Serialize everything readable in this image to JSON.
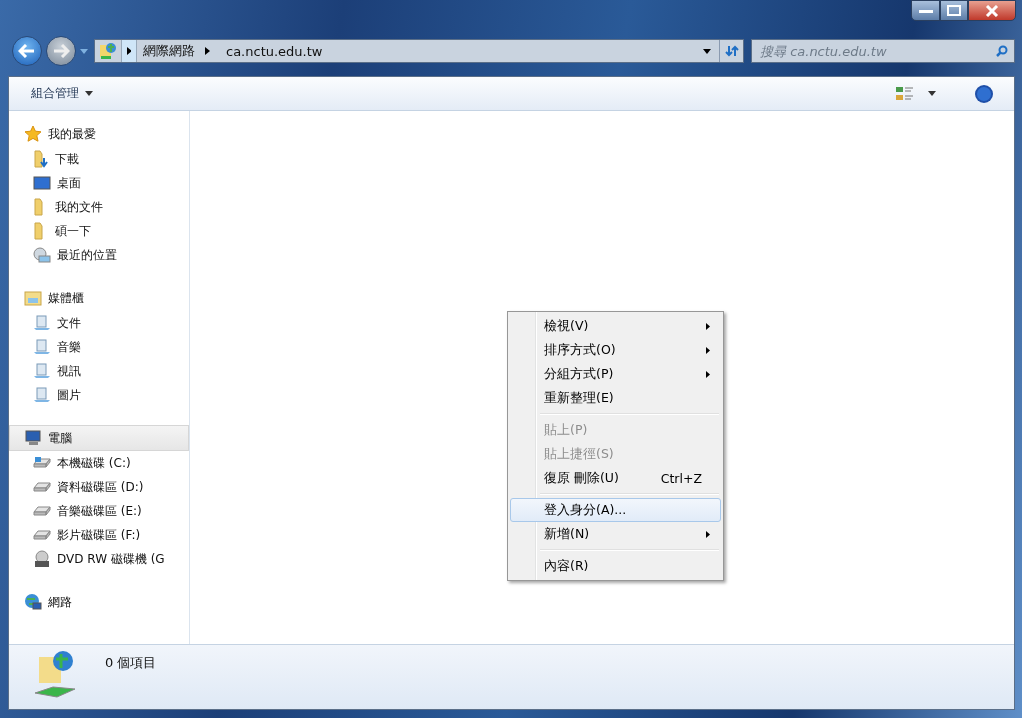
{
  "address_bar": {
    "segments": [
      "網際網路",
      "ca.nctu.edu.tw"
    ]
  },
  "search": {
    "placeholder": "搜尋 ca.nctu.edu.tw"
  },
  "toolbar": {
    "organize": "組合管理"
  },
  "sidebar": {
    "groups": [
      {
        "label": "我的最愛",
        "selected": false,
        "items": [
          {
            "label": "下載"
          },
          {
            "label": "桌面"
          },
          {
            "label": "我的文件"
          },
          {
            "label": "碩一下"
          },
          {
            "label": "最近的位置"
          }
        ]
      },
      {
        "label": "媒體櫃",
        "selected": false,
        "items": [
          {
            "label": "文件"
          },
          {
            "label": "音樂"
          },
          {
            "label": "視訊"
          },
          {
            "label": "圖片"
          }
        ]
      },
      {
        "label": "電腦",
        "selected": true,
        "items": [
          {
            "label": "本機磁碟 (C:)"
          },
          {
            "label": "資料磁碟區 (D:)"
          },
          {
            "label": "音樂磁碟區 (E:)"
          },
          {
            "label": "影片磁碟區 (F:)"
          },
          {
            "label": "DVD RW 磁碟機 (G"
          }
        ]
      },
      {
        "label": "網路",
        "selected": false
      }
    ]
  },
  "context_menu": {
    "sections": [
      [
        {
          "label": "檢視(V)",
          "submenu": true,
          "disabled": false,
          "selected": false
        },
        {
          "label": "排序方式(O)",
          "submenu": true,
          "disabled": false,
          "selected": false
        },
        {
          "label": "分組方式(P)",
          "submenu": true,
          "disabled": false,
          "selected": false
        },
        {
          "label": "重新整理(E)",
          "submenu": false,
          "disabled": false,
          "selected": false
        }
      ],
      [
        {
          "label": "貼上(P)",
          "submenu": false,
          "disabled": true,
          "selected": false
        },
        {
          "label": "貼上捷徑(S)",
          "submenu": false,
          "disabled": true,
          "selected": false
        },
        {
          "label": "復原 刪除(U)",
          "shortcut": "Ctrl+Z",
          "submenu": false,
          "disabled": false,
          "selected": false
        }
      ],
      [
        {
          "label": "登入身分(A)...",
          "submenu": false,
          "disabled": false,
          "selected": true
        },
        {
          "label": "新增(N)",
          "submenu": true,
          "disabled": false,
          "selected": false
        }
      ],
      [
        {
          "label": "內容(R)",
          "submenu": false,
          "disabled": false,
          "selected": false
        }
      ]
    ]
  },
  "status_bar": {
    "text": "0 個項目"
  }
}
